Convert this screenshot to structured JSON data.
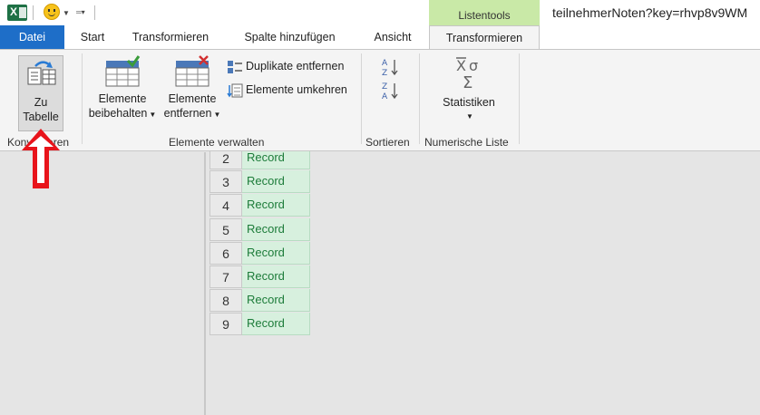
{
  "app": {
    "window_title": "teilnehmerNoten?key=rhvp8v9WM",
    "contextual_group": "Listentools",
    "icon_letter": "X"
  },
  "tabs": [
    {
      "label": "Datei"
    },
    {
      "label": "Start"
    },
    {
      "label": "Transformieren"
    },
    {
      "label": "Spalte hinzufügen"
    },
    {
      "label": "Ansicht"
    },
    {
      "label": "Transformieren"
    }
  ],
  "ribbon": {
    "convert": {
      "button_line1": "Zu",
      "button_line2": "Tabelle",
      "group_label": "Konvertieren"
    },
    "manage": {
      "keep_line1": "Elemente",
      "keep_line2": "beibehalten",
      "remove_line1": "Elemente",
      "remove_line2": "entfernen",
      "dedupe": "Duplikate entfernen",
      "reverse": "Elemente umkehren",
      "group_label": "Elemente verwalten"
    },
    "sort": {
      "group_label": "Sortieren"
    },
    "numeric": {
      "stats_label": "Statistiken",
      "group_label": "Numerische Liste"
    }
  },
  "list": {
    "rows": [
      {
        "num": "2",
        "value": "Record"
      },
      {
        "num": "3",
        "value": "Record"
      },
      {
        "num": "4",
        "value": "Record"
      },
      {
        "num": "5",
        "value": "Record"
      },
      {
        "num": "6",
        "value": "Record"
      },
      {
        "num": "7",
        "value": "Record"
      },
      {
        "num": "8",
        "value": "Record"
      },
      {
        "num": "9",
        "value": "Record"
      }
    ]
  },
  "colors": {
    "file_tab": "#1e6ec8",
    "contextual": "#c9e9a7",
    "record_cell": "#d7f0de",
    "annotation_arrow": "#e8141b"
  }
}
